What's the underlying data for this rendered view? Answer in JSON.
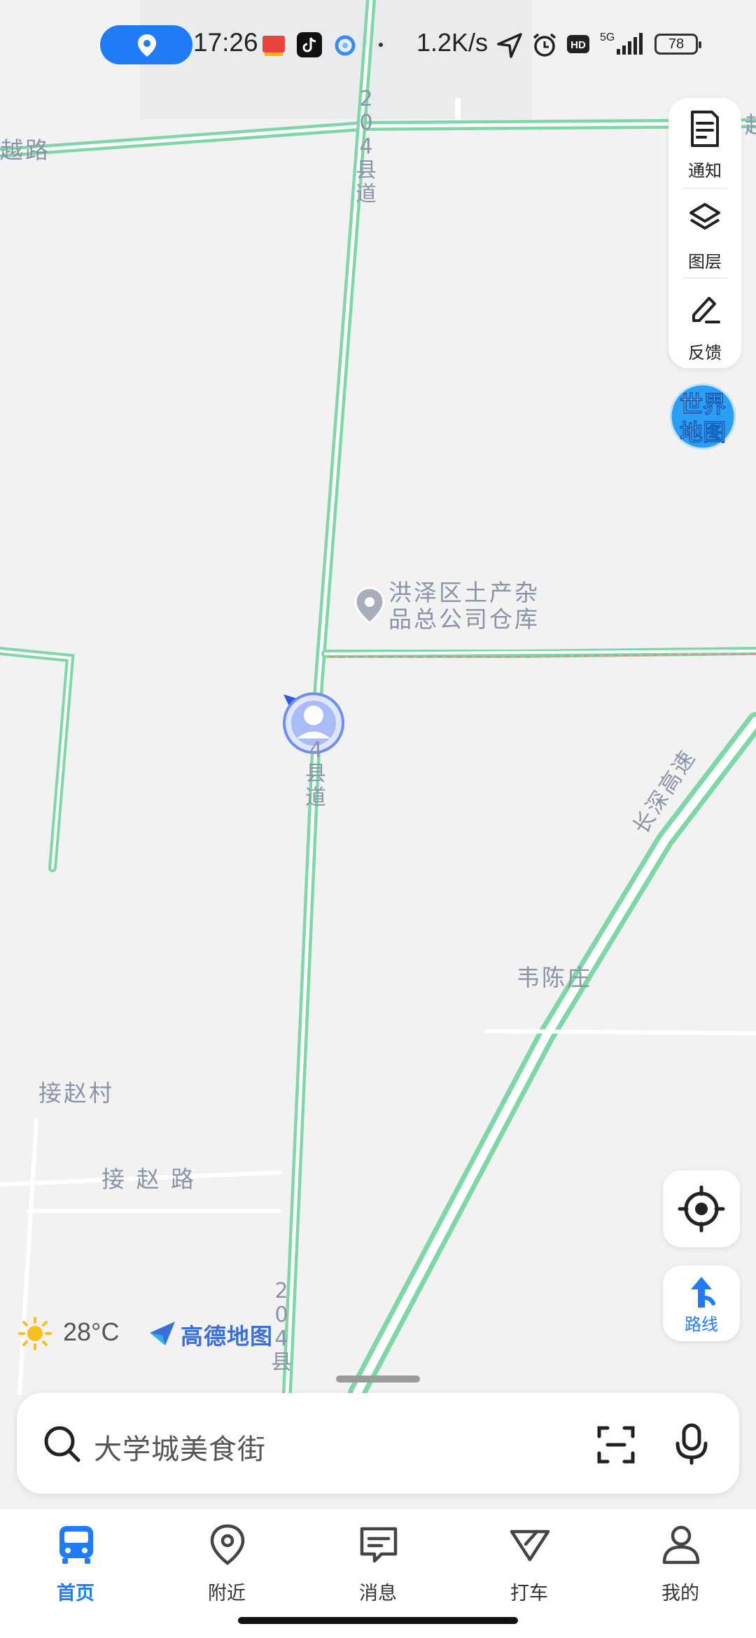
{
  "status_bar": {
    "time": "17:26",
    "network_speed": "1.2K/s",
    "battery": "78",
    "signal": "5G",
    "hd_badge": "HD",
    "app_icons": [
      "location-pill-icon",
      "baidu-search-icon",
      "douyin-icon",
      "browser-icon"
    ]
  },
  "map": {
    "labels": {
      "road_top_left": "越路",
      "road_top_right": "越",
      "county_road_top": "204县道",
      "county_road_mid": "4县道",
      "county_road_bottom": "204县",
      "poi_name_line1": "洪泽区土产杂",
      "poi_name_line2": "品总公司仓库",
      "expressway": "长深高速",
      "village_wei": "韦陈庄",
      "village_jie": "接赵村",
      "road_jie": "接 赵 路"
    }
  },
  "tools": {
    "notice": "通知",
    "layers": "图层",
    "feedback": "反馈",
    "world_map_line1": "世界",
    "world_map_line2": "地图",
    "route": "路线"
  },
  "weather": {
    "temperature": "28°C"
  },
  "brand": {
    "name": "高德地图"
  },
  "search": {
    "placeholder": "大学城美食街"
  },
  "nav": {
    "items": [
      {
        "label": "首页",
        "active": true
      },
      {
        "label": "附近",
        "active": false
      },
      {
        "label": "消息",
        "active": false
      },
      {
        "label": "打车",
        "active": false
      },
      {
        "label": "我的",
        "active": false
      }
    ]
  },
  "colors": {
    "accent": "#1f7cf6",
    "road": "#7fd7a8",
    "map_bg": "#f2f2f3"
  }
}
